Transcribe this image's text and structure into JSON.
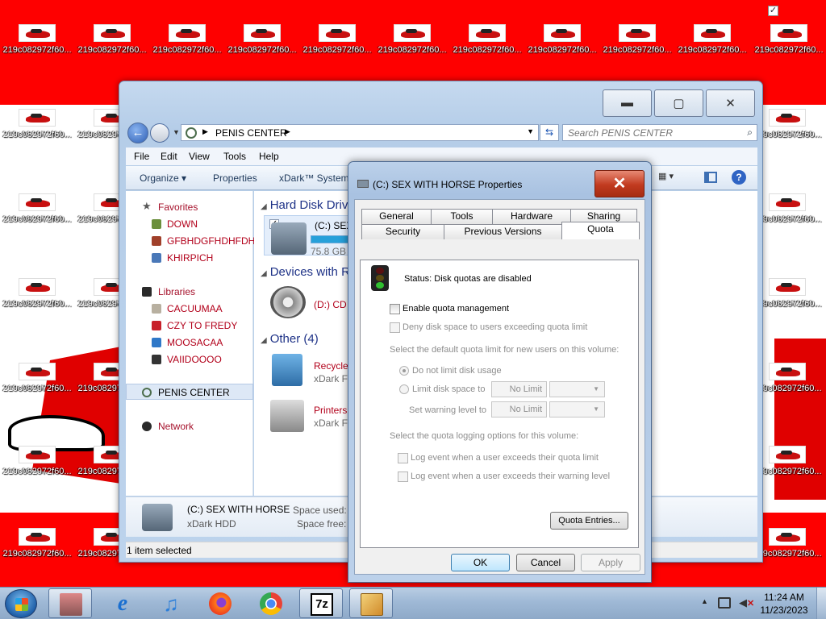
{
  "desktop": {
    "icon_caption": "219c082972f60...",
    "checkbox_mark": "✓"
  },
  "explorer": {
    "address": {
      "location": "PENIS CENTER"
    },
    "search": {
      "placeholder": "Search PENIS CENTER"
    },
    "menu": [
      "File",
      "Edit",
      "View",
      "Tools",
      "Help"
    ],
    "toolbar": {
      "organize": "Organize ▾",
      "properties": "Properties",
      "system": "xDark™ System"
    },
    "nav": {
      "favorites": {
        "label": "Favorites",
        "items": [
          "DOWN",
          "GFBHDGFHDHFDH",
          "KHIRPICH"
        ]
      },
      "libraries": {
        "label": "Libraries",
        "items": [
          "CACUUMAA",
          "CZY TO FREDY",
          "MOOSACAA",
          "VAIIDOOOO"
        ]
      },
      "computer": "PENIS CENTER",
      "network": "Network"
    },
    "groups": {
      "hdd": "Hard Disk Driv",
      "devices": "Devices with R",
      "other": "Other (4)"
    },
    "items": {
      "drive_c": {
        "name": "(C:) SEX W",
        "free": "75.8 GB f"
      },
      "drive_d": {
        "name": "(D:) CD D"
      },
      "recycle": {
        "name": "Recycle I",
        "sub": "xDark Fo"
      },
      "printers": {
        "name": "Printers",
        "sub": "xDark Fo"
      }
    },
    "details": {
      "name": "(C:) SEX WITH HORSE",
      "type": "xDark HDD",
      "space_used_label": "Space used:",
      "space_free_label": "Space free:"
    },
    "status": "1 item selected"
  },
  "properties": {
    "title": "(C:) SEX WITH HORSE Properties",
    "close_glyph": "✕",
    "tabs_row1": [
      "General",
      "Tools",
      "Hardware",
      "Sharing"
    ],
    "tabs_row2": [
      "Security",
      "Previous Versions",
      "Quota"
    ],
    "quota": {
      "status": "Status:  Disk quotas are disabled",
      "enable": "Enable quota management",
      "deny": "Deny disk space to users exceeding quota limit",
      "default_heading": "Select the default quota limit for new users on this volume:",
      "no_limit_option": "Do not limit disk usage",
      "limit_option": "Limit disk space to",
      "warning_option": "Set warning level to",
      "limit_value": "No Limit",
      "warning_value": "No Limit",
      "logging_heading": "Select the quota logging options for this volume:",
      "log_limit": "Log event when a user exceeds their quota limit",
      "log_warning": "Log event when a user exceeds their warning level",
      "entries_button": "Quota Entries..."
    },
    "buttons": {
      "ok": "OK",
      "cancel": "Cancel",
      "apply": "Apply"
    }
  },
  "taskbar": {
    "time": "11:24 AM",
    "date": "11/23/2023",
    "apps": [
      "app-icon",
      "internet-explorer-icon",
      "itunes-icon",
      "firefox-icon",
      "chrome-icon",
      "7zip-icon",
      "tool-icon"
    ],
    "app_7zip_text": "7z"
  },
  "colors": {
    "desktop_red": "#fe0000",
    "link_red": "#b2001a",
    "accent_blue": "#1e3287"
  }
}
